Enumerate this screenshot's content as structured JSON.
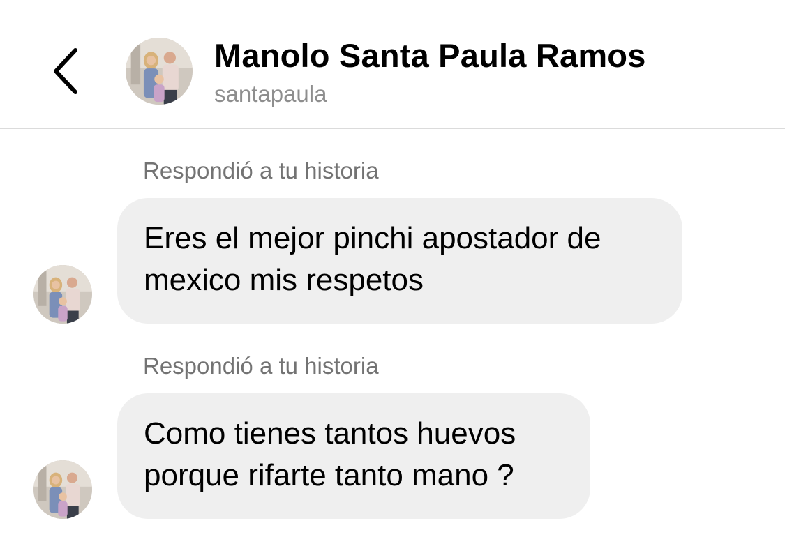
{
  "header": {
    "back_icon": "chevron-left-icon",
    "contact_name": "Manolo Santa Paula Ramos",
    "contact_handle": "santapaula"
  },
  "messages": [
    {
      "reply_label": "Respondió a tu historia",
      "lines": [
        "Eres el mejor pinchi apostador de",
        "mexico mis respetos"
      ]
    },
    {
      "reply_label": "Respondió a tu historia",
      "lines": [
        "Como tienes tantos huevos",
        "porque rifarte tanto mano ?"
      ]
    }
  ],
  "colors": {
    "bubble_bg": "#efefef",
    "secondary_text": "#8e8e8e",
    "divider": "#dbdbdb"
  }
}
